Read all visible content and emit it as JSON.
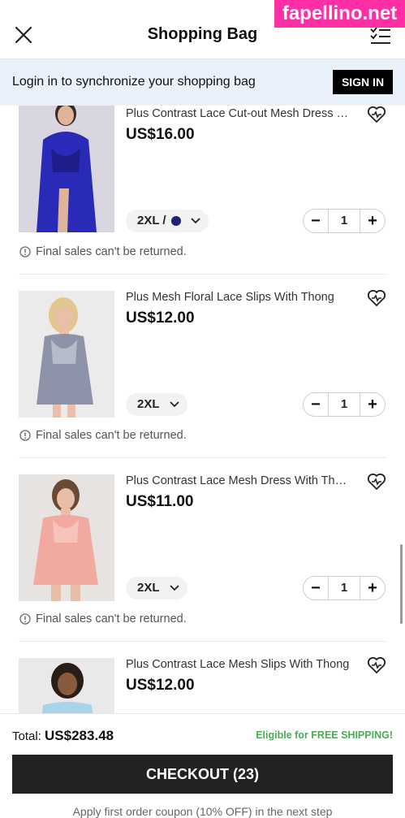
{
  "header": {
    "title": "Shopping Bag"
  },
  "watermark": "fapellino.net",
  "login_bar": {
    "message": "Login in to synchronize your shopping bag",
    "button": "SIGN IN"
  },
  "items": [
    {
      "name": "Plus Contrast Lace Cut-out Mesh Dress With Thong",
      "price": "US$16.00",
      "size": "2XL /",
      "color_swatch": "#1a2470",
      "quantity": "1",
      "notice": "Final sales can't be returned."
    },
    {
      "name": "Plus Mesh Floral Lace Slips With Thong",
      "price": "US$12.00",
      "size": "2XL",
      "quantity": "1",
      "notice": "Final sales can't be returned."
    },
    {
      "name": "Plus Contrast Lace Mesh Dress With Thong",
      "price": "US$11.00",
      "size": "2XL",
      "quantity": "1",
      "notice": "Final sales can't be returned."
    },
    {
      "name": "Plus Contrast Lace Mesh Slips With Thong",
      "price": "US$12.00"
    }
  ],
  "stepper": {
    "minus": "−",
    "plus": "+"
  },
  "footer": {
    "total_label": "Total:",
    "total_value": "US$283.48",
    "shipping_note": "Eligible for FREE SHIPPING!",
    "checkout": "CHECKOUT (23)",
    "coupon_note": "Apply first order coupon (10% OFF) in the next step"
  },
  "colors": {
    "accent": "#ff2fa6",
    "login_bar_bg": "#e8f0fa",
    "free_shipping": "#4caa5a",
    "checkout_bg": "#222222"
  }
}
